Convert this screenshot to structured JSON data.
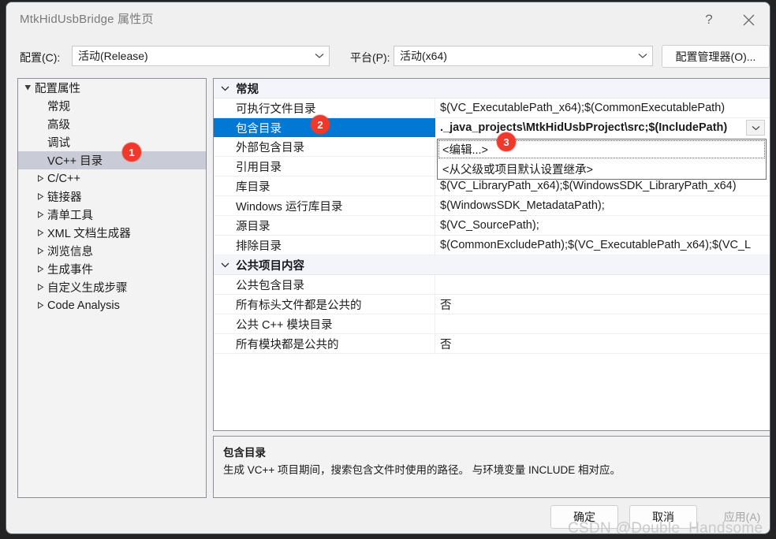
{
  "window": {
    "title": "MtkHidUsbBridge 属性页",
    "help_icon": "?",
    "close_icon": "close-icon"
  },
  "config_bar": {
    "config_label": "配置(C):",
    "config_value": "活动(Release)",
    "platform_label": "平台(P):",
    "platform_value": "活动(x64)",
    "config_manager_button": "配置管理器(O)..."
  },
  "tree": {
    "items": [
      {
        "label": "配置属性",
        "indent": 0,
        "twisty": "expanded",
        "selected": false
      },
      {
        "label": "常规",
        "indent": 1,
        "twisty": "none",
        "selected": false
      },
      {
        "label": "高级",
        "indent": 1,
        "twisty": "none",
        "selected": false
      },
      {
        "label": "调试",
        "indent": 1,
        "twisty": "none",
        "selected": false
      },
      {
        "label": "VC++ 目录",
        "indent": 1,
        "twisty": "none",
        "selected": true
      },
      {
        "label": "C/C++",
        "indent": 1,
        "twisty": "collapsed",
        "selected": false
      },
      {
        "label": "链接器",
        "indent": 1,
        "twisty": "collapsed",
        "selected": false
      },
      {
        "label": "清单工具",
        "indent": 1,
        "twisty": "collapsed",
        "selected": false
      },
      {
        "label": "XML 文档生成器",
        "indent": 1,
        "twisty": "collapsed",
        "selected": false
      },
      {
        "label": "浏览信息",
        "indent": 1,
        "twisty": "collapsed",
        "selected": false
      },
      {
        "label": "生成事件",
        "indent": 1,
        "twisty": "collapsed",
        "selected": false
      },
      {
        "label": "自定义生成步骤",
        "indent": 1,
        "twisty": "collapsed",
        "selected": false
      },
      {
        "label": "Code Analysis",
        "indent": 1,
        "twisty": "collapsed",
        "selected": false
      }
    ]
  },
  "grid": {
    "groups": [
      {
        "title": "常规",
        "rows": [
          {
            "name": "可执行文件目录",
            "value": "$(VC_ExecutablePath_x64);$(CommonExecutablePath)",
            "selected": false
          },
          {
            "name": "包含目录",
            "value": "._java_projects\\MtkHidUsbProject\\src;$(IncludePath)",
            "selected": true
          },
          {
            "name": "外部包含目录",
            "value": "",
            "selected": false
          },
          {
            "name": "引用目录",
            "value": "",
            "selected": false
          },
          {
            "name": "库目录",
            "value": "$(VC_LibraryPath_x64);$(WindowsSDK_LibraryPath_x64)",
            "selected": false
          },
          {
            "name": "Windows 运行库目录",
            "value": "$(WindowsSDK_MetadataPath);",
            "selected": false
          },
          {
            "name": "源目录",
            "value": "$(VC_SourcePath);",
            "selected": false
          },
          {
            "name": "排除目录",
            "value": "$(CommonExcludePath);$(VC_ExecutablePath_x64);$(VC_L",
            "selected": false
          }
        ]
      },
      {
        "title": "公共项目内容",
        "rows": [
          {
            "name": "公共包含目录",
            "value": "",
            "selected": false
          },
          {
            "name": "所有标头文件都是公共的",
            "value": "否",
            "selected": false
          },
          {
            "name": "公共 C++ 模块目录",
            "value": "",
            "selected": false
          },
          {
            "name": "所有模块都是公共的",
            "value": "否",
            "selected": false
          }
        ]
      }
    ]
  },
  "dropdown": {
    "items": [
      {
        "label": "<编辑...>",
        "focused": true
      },
      {
        "label": "<从父级或项目默认设置继承>",
        "focused": false
      }
    ]
  },
  "description": {
    "title": "包含目录",
    "body": "生成 VC++ 项目期间，搜索包含文件时使用的路径。 与环境变量 INCLUDE 相对应。"
  },
  "footer": {
    "ok": "确定",
    "cancel": "取消",
    "apply": "应用(A)"
  },
  "badges": [
    {
      "number": "1"
    },
    {
      "number": "2"
    },
    {
      "number": "3"
    }
  ],
  "watermark": "CSDN @Double_Handsome",
  "colors": {
    "selection_blue": "#0078d4",
    "tree_selection": "#c9cbd6",
    "badge_red": "#f0392b",
    "group_header_bg": "#f3f5fa",
    "dialog_bg": "#f0f0f0"
  }
}
